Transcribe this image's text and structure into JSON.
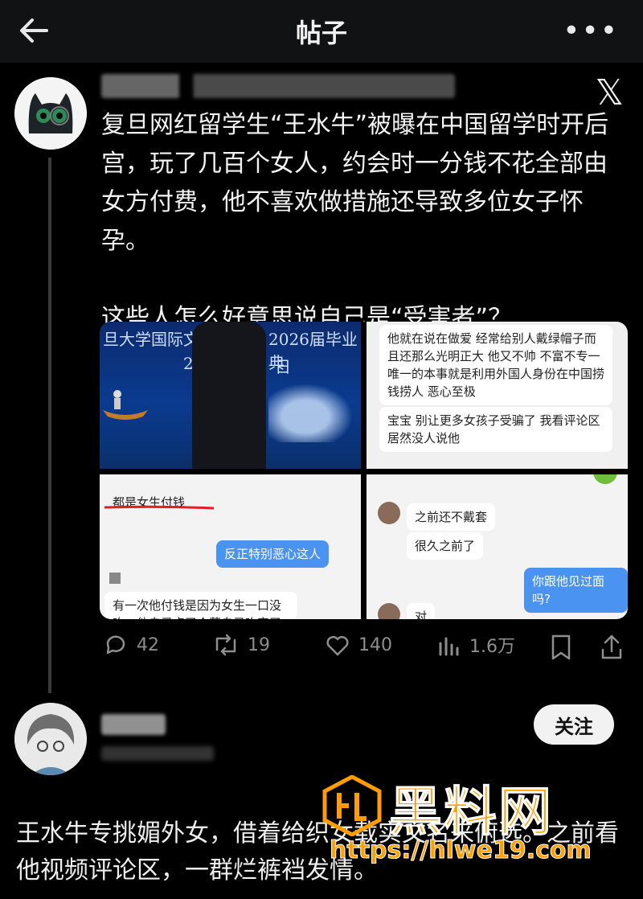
{
  "header": {
    "title": "帖子",
    "back_icon": "arrow-left-icon",
    "more_label": "•••"
  },
  "embedded_post": {
    "platform_icon": "x-logo-icon",
    "text": [
      "复旦网红留学生“王水牛”被曝在中国留学时开后宫，玩了几百个女人，约会时一分钱不花全部由女方付费，他不喜欢做措施还导致多位女子怀孕。",
      "这些人怎么好意思说自己是“受害者”？"
    ],
    "media": {
      "stage_left": "旦大学国际文",
      "stage_right": "2026届毕业典",
      "stage_sub_left": "2",
      "stage_sub_right": "日",
      "p2_msg1": "他就在说在做爱 经常给别人戴绿帽子而且还那么光明正大 他又不帅 不富不专一 唯一的本事就是利用外国人身份在中国捞钱捞人 恶心至极",
      "p2_msg2": "宝宝 别让更多女孩子受骗了 我看评论区居然没人说他",
      "p3_msg1": "都是女生付钱",
      "p3_msg2": "反正特别恶心这人",
      "p3_msg3": "有一次他付钱是因为女生一口没吃，他自己点了个菜自己吃完了",
      "p4_msg1": "之前还不戴套",
      "p4_msg2": "很久之前了",
      "p4_msg3": "你跟他见过面吗?",
      "p4_msg4": "对"
    }
  },
  "actions": {
    "replies": "42",
    "reposts": "19",
    "likes": "140",
    "views": "1.6万"
  },
  "reply": {
    "follow_label": "关注",
    "text": "王水牛专挑媚外女，借着给织女载实文名来俯选。之前看他视频评论区，一群烂裤裆发情。"
  },
  "watermark": {
    "brand": "黑料网",
    "url": "https://hlwe19.com"
  },
  "colors": {
    "accent_orange": "#ff9d00",
    "link_blue": "#4b93f0",
    "background": "#000000"
  }
}
